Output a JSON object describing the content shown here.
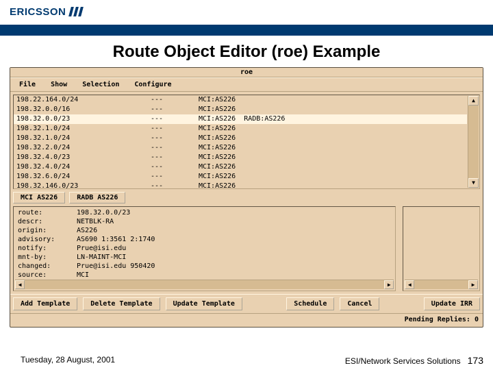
{
  "brand": {
    "logo_text": "ERICSSON"
  },
  "slide": {
    "title": "Route Object Editor (roe) Example"
  },
  "app": {
    "window_title": "roe",
    "menus": [
      "File",
      "Show",
      "Selection",
      "Configure"
    ],
    "rows": [
      {
        "prefix": "198.22.164.0/24",
        "mid": "---",
        "db": "MCI:AS226",
        "selected": false
      },
      {
        "prefix": "198.32.0.0/16",
        "mid": "---",
        "db": "MCI:AS226",
        "selected": false
      },
      {
        "prefix": "198.32.0.0/23",
        "mid": "---",
        "db": "MCI:AS226  RADB:AS226",
        "selected": true
      },
      {
        "prefix": "198.32.1.0/24",
        "mid": "---",
        "db": "MCI:AS226",
        "selected": false
      },
      {
        "prefix": "198.32.1.0/24",
        "mid": "---",
        "db": "MCI:AS226",
        "selected": false
      },
      {
        "prefix": "198.32.2.0/24",
        "mid": "---",
        "db": "MCI:AS226",
        "selected": false
      },
      {
        "prefix": "198.32.4.0/23",
        "mid": "---",
        "db": "MCI:AS226",
        "selected": false
      },
      {
        "prefix": "198.32.4.0/24",
        "mid": "---",
        "db": "MCI:AS226",
        "selected": false
      },
      {
        "prefix": "198.32.6.0/24",
        "mid": "---",
        "db": "MCI:AS226",
        "selected": false
      },
      {
        "prefix": "198.32.146.0/23",
        "mid": "---",
        "db": "MCI:AS226",
        "selected": false
      }
    ],
    "tabs": [
      "MCI AS226",
      "RADB AS226"
    ],
    "detail": [
      {
        "k": "route:",
        "v": "198.32.0.0/23"
      },
      {
        "k": "descr:",
        "v": "NETBLK-RA"
      },
      {
        "k": "origin:",
        "v": "AS226"
      },
      {
        "k": "advisory:",
        "v": "AS690 1:3561 2:1740"
      },
      {
        "k": "notify:",
        "v": "Prue@isi.edu"
      },
      {
        "k": "mnt-by:",
        "v": "LN-MAINT-MCI"
      },
      {
        "k": "changed:",
        "v": "Prue@isi.edu 950420"
      },
      {
        "k": "source:",
        "v": "MCI"
      }
    ],
    "buttons": {
      "add": "Add Template",
      "delete": "Delete Template",
      "update": "Update Template",
      "schedule": "Schedule",
      "cancel": "Cancel",
      "update_irr": "Update IRR"
    },
    "status": "Pending Replies: 0"
  },
  "footer": {
    "left": "Tuesday, 28 August, 2001",
    "right": "ESI/Network Services Solutions",
    "page": "173"
  },
  "glyph": {
    "up": "▲",
    "down": "▼",
    "left": "◀",
    "right": "▶"
  }
}
